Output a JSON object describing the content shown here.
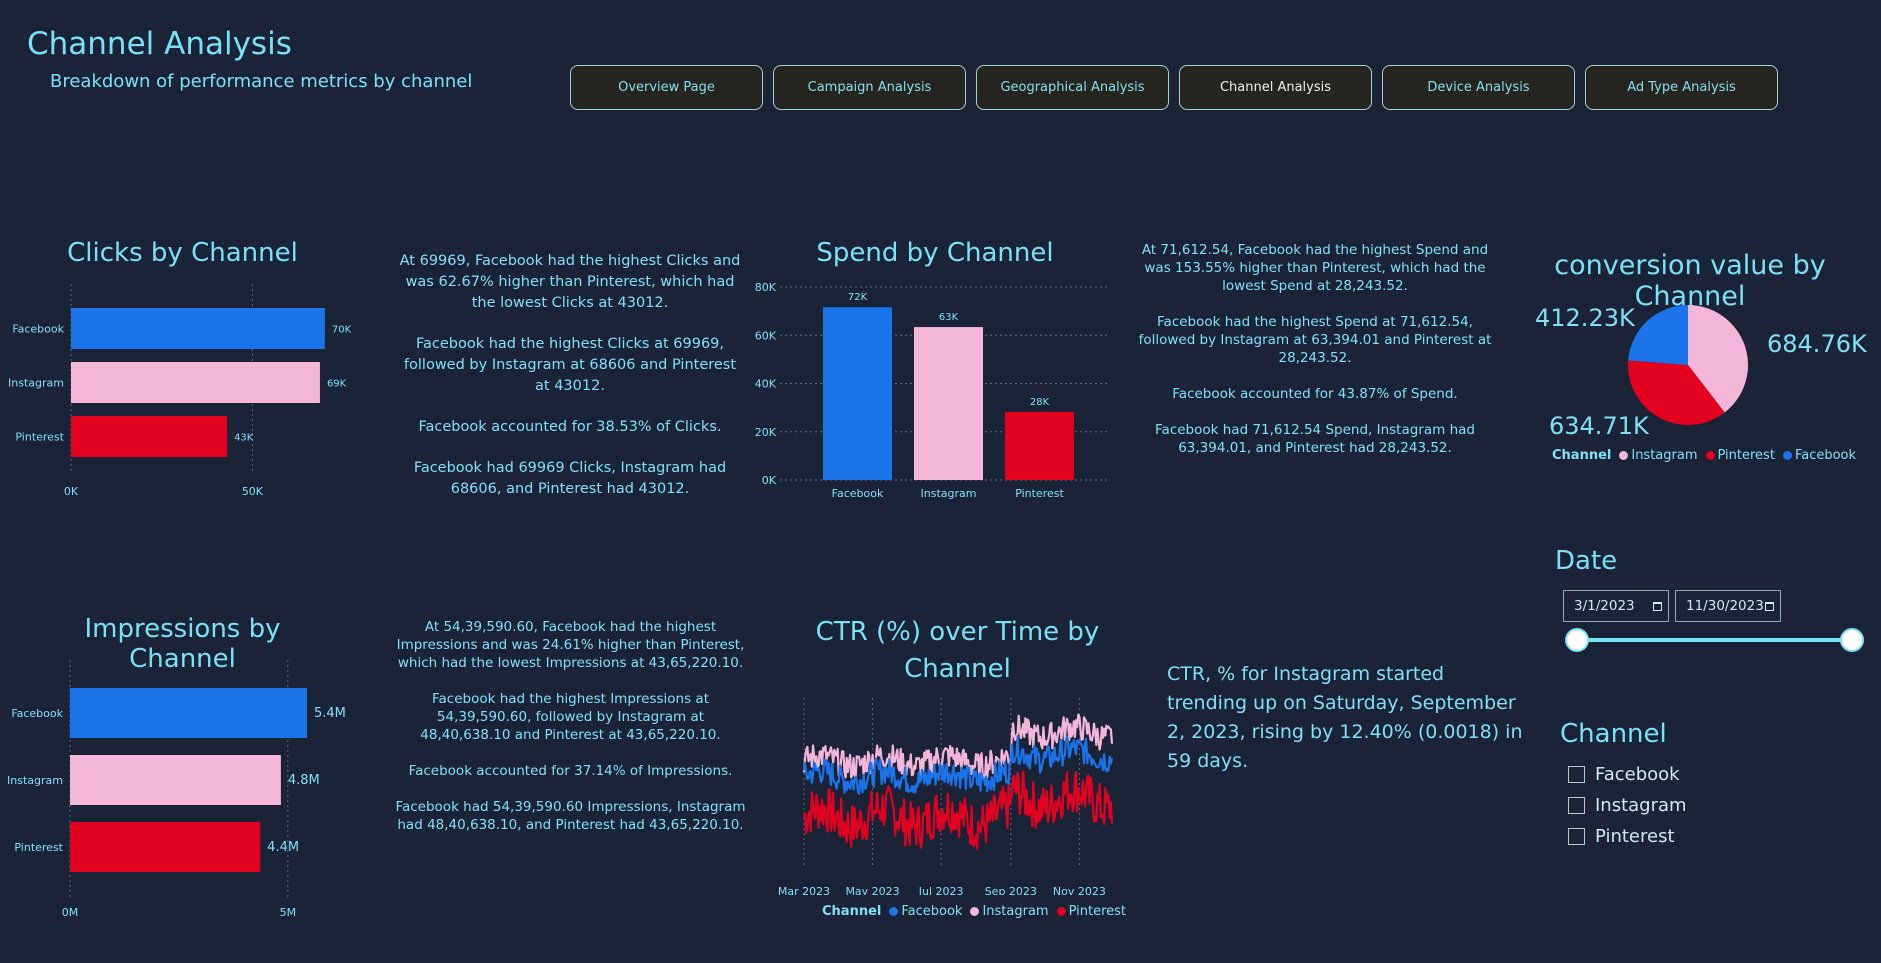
{
  "header": {
    "title": "Channel Analysis",
    "subtitle": "Breakdown of performance metrics by channel"
  },
  "nav": {
    "buttons": [
      {
        "label": "Overview Page",
        "active": false
      },
      {
        "label": "Campaign Analysis",
        "active": false
      },
      {
        "label": "Geographical Analysis",
        "active": false
      },
      {
        "label": "Channel Analysis",
        "active": true
      },
      {
        "label": "Device Analysis",
        "active": false
      },
      {
        "label": "Ad Type Analysis",
        "active": false
      }
    ]
  },
  "colors": {
    "facebook": "#1a73e8",
    "instagram": "#f3b6d8",
    "pinterest": "#e3001f",
    "background": "#1b2337",
    "accent": "#79e1f4"
  },
  "clicks": {
    "title": "Clicks by Channel",
    "narrative": [
      "At 69969, Facebook had the highest Clicks and was 62.67% higher than Pinterest, which had the lowest Clicks at 43012.",
      "Facebook had the highest Clicks at 69969, followed by Instagram at 68606 and Pinterest at 43012.",
      "Facebook accounted for 38.53% of Clicks.",
      "Facebook had 69969 Clicks, Instagram had 68606, and Pinterest had 43012."
    ]
  },
  "spend": {
    "title": "Spend by Channel",
    "narrative": [
      "At 71,612.54, Facebook had the highest Spend and was 153.55% higher than Pinterest, which had the lowest Spend at 28,243.52.",
      "Facebook had the highest Spend at 71,612.54, followed by Instagram at 63,394.01 and Pinterest at 28,243.52.",
      "Facebook accounted for 43.87% of Spend.",
      "Facebook had 71,612.54 Spend, Instagram had 63,394.01, and Pinterest had 28,243.52."
    ]
  },
  "conversion": {
    "title": "conversion value by Channel",
    "legend_title": "Channel",
    "legend": [
      "Instagram",
      "Pinterest",
      "Facebook"
    ]
  },
  "impressions": {
    "title": "Impressions by Channel",
    "narrative": [
      "At 54,39,590.60, Facebook had the highest Impressions and was 24.61% higher than Pinterest, which had the lowest Impressions at 43,65,220.10.",
      "Facebook had the highest Impressions at 54,39,590.60, followed by Instagram at 48,40,638.10 and Pinterest at 43,65,220.10.",
      "Facebook accounted for 37.14% of Impressions.",
      "Facebook had 54,39,590.60 Impressions, Instagram had 48,40,638.10, and Pinterest had 43,65,220.10."
    ]
  },
  "ctr": {
    "title": "CTR (%) over Time by Channel",
    "legend_title": "Channel",
    "legend": [
      "Facebook",
      "Instagram",
      "Pinterest"
    ],
    "insight": "CTR, % for Instagram started trending up on Saturday, September 2, 2023, rising by 12.40% (0.0018) in 59 days."
  },
  "date_slicer": {
    "title": "Date",
    "start": "3/1/2023",
    "end": "11/30/2023"
  },
  "channel_slicer": {
    "title": "Channel",
    "options": [
      "Facebook",
      "Instagram",
      "Pinterest"
    ]
  },
  "chart_data": [
    {
      "type": "bar",
      "orientation": "horizontal",
      "title": "Clicks by Channel",
      "categories": [
        "Facebook",
        "Instagram",
        "Pinterest"
      ],
      "values": [
        69969,
        68606,
        43012
      ],
      "data_labels": [
        "70K",
        "69K",
        "43K"
      ],
      "xticks": [
        "0K",
        "50K"
      ],
      "xlim": [
        0,
        70000
      ],
      "grid": true
    },
    {
      "type": "bar",
      "orientation": "vertical",
      "title": "Spend by Channel",
      "categories": [
        "Facebook",
        "Instagram",
        "Pinterest"
      ],
      "values": [
        71612.54,
        63394.01,
        28243.52
      ],
      "data_labels": [
        "72K",
        "63K",
        "28K"
      ],
      "yticks": [
        "0K",
        "20K",
        "40K",
        "60K",
        "80K"
      ],
      "ylim": [
        0,
        80000
      ],
      "grid": true
    },
    {
      "type": "pie",
      "title": "conversion value by Channel",
      "labels": [
        "Instagram",
        "Pinterest",
        "Facebook"
      ],
      "values": [
        684760,
        634710,
        412230
      ],
      "data_labels": [
        "684.76K",
        "634.71K",
        "412.23K"
      ]
    },
    {
      "type": "bar",
      "orientation": "horizontal",
      "title": "Impressions by Channel",
      "categories": [
        "Facebook",
        "Instagram",
        "Pinterest"
      ],
      "values": [
        5439590.6,
        4840638.1,
        4365220.1
      ],
      "data_labels": [
        "5.4M",
        "4.8M",
        "4.4M"
      ],
      "xticks": [
        "0M",
        "5M"
      ],
      "xlim": [
        0,
        5440000
      ],
      "grid": true
    },
    {
      "type": "line",
      "title": "CTR (%) over Time by Channel",
      "x_range": [
        "2023-03-01",
        "2023-11-30"
      ],
      "xticks": [
        "Mar 2023",
        "May 2023",
        "Jul 2023",
        "Sep 2023",
        "Nov 2023"
      ],
      "series": [
        {
          "name": "Facebook",
          "pattern": {
            "before_sep": 0.0149,
            "after_sep": 0.0162,
            "noise": 0.0008
          }
        },
        {
          "name": "Instagram",
          "pattern": {
            "before_sep": 0.0158,
            "after_sep": 0.0175,
            "noise": 0.0008
          }
        },
        {
          "name": "Pinterest",
          "pattern": {
            "before_sep": 0.0125,
            "after_sep": 0.0136,
            "noise": 0.0014
          }
        }
      ],
      "ylim": [
        0.0095,
        0.0195
      ],
      "grid": true
    }
  ]
}
